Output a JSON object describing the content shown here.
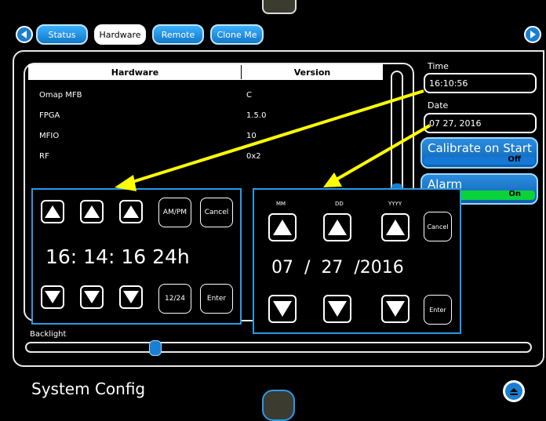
{
  "tabs": [
    {
      "label": "Status"
    },
    {
      "label": "Hardware"
    },
    {
      "label": "Remote"
    },
    {
      "label": "Clone Me"
    }
  ],
  "hardware_table": {
    "headers": [
      "Hardware",
      "Version"
    ],
    "rows": [
      {
        "name": "Omap MFB",
        "version": "C"
      },
      {
        "name": "FPGA",
        "version": "1.5.0"
      },
      {
        "name": "MFIO",
        "version": "10"
      },
      {
        "name": "RF",
        "version": "0x2"
      }
    ]
  },
  "time": {
    "label": "Time",
    "value": "16:10:56"
  },
  "date": {
    "label": "Date",
    "value": "07 27, 2016"
  },
  "calibrate": {
    "label": "Calibrate on Start",
    "state": "Off"
  },
  "alarm": {
    "label": "Alarm",
    "state": "On"
  },
  "backlight": {
    "label": "Backlight",
    "level": 0.28
  },
  "footer": {
    "title": "System Config"
  },
  "time_popup": {
    "display": "16: 14: 16 24h",
    "ampm": "AM/PM",
    "cancel": "Cancel",
    "mode": "12/24",
    "enter": "Enter"
  },
  "date_popup": {
    "mm": "MM",
    "dd": "DD",
    "yyyy": "YYYY",
    "display": "07  /  27  /2016",
    "cancel": "Cancel",
    "enter": "Enter"
  },
  "colors": {
    "accent": "#1a7fd0",
    "on": "#0ad33a",
    "arrow": "#ffff00",
    "popup_border": "#2a9ae8"
  }
}
